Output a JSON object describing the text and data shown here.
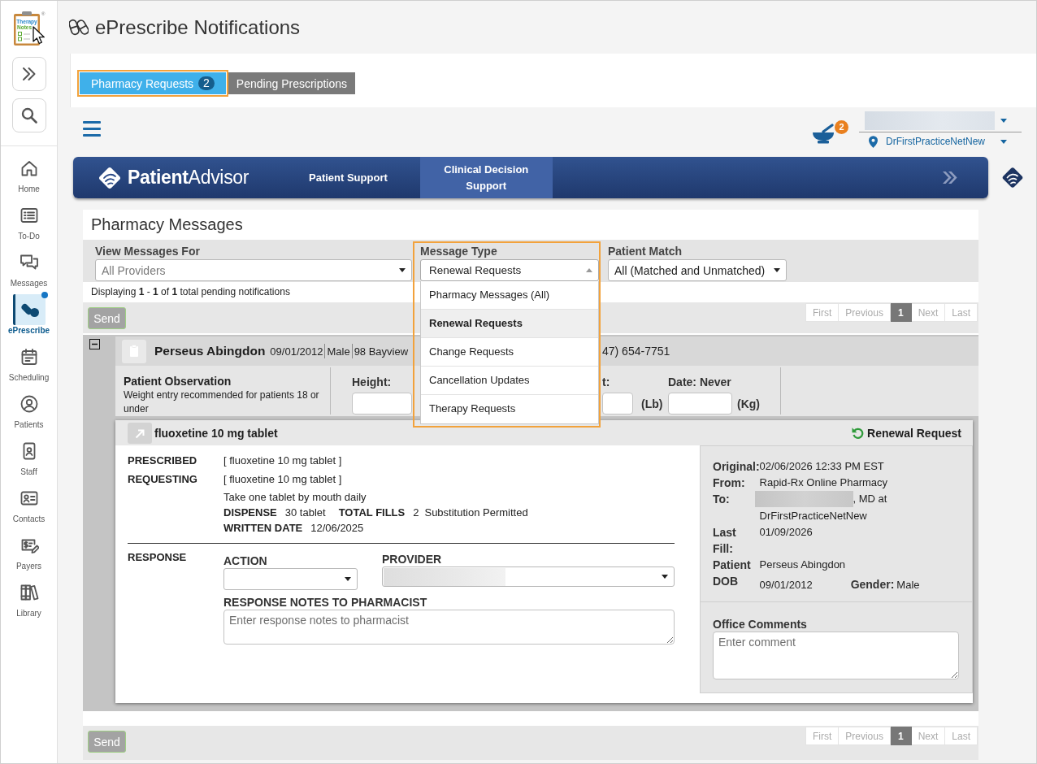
{
  "app_logo": {
    "line_1": "Therapy",
    "line_2": "Notes",
    "mark": "®"
  },
  "sidebar": {
    "items": [
      {
        "label": "Home",
        "selected": false,
        "dot": false
      },
      {
        "label": "To-Do",
        "selected": false,
        "dot": false
      },
      {
        "label": "Messages",
        "selected": false,
        "dot": false
      },
      {
        "label": "ePrescribe",
        "selected": true,
        "dot": true
      },
      {
        "label": "Scheduling",
        "selected": false,
        "dot": false
      },
      {
        "label": "Patients",
        "selected": false,
        "dot": false
      },
      {
        "label": "Staff",
        "selected": false,
        "dot": false
      },
      {
        "label": "Contacts",
        "selected": false,
        "dot": false
      },
      {
        "label": "Payers",
        "selected": false,
        "dot": false
      },
      {
        "label": "Library",
        "selected": false,
        "dot": false
      }
    ]
  },
  "page_title": "ePrescribe Notifications",
  "tabs": [
    {
      "label": "Pharmacy Requests",
      "count": "2",
      "selected": true,
      "highlighted": true
    },
    {
      "label": "Pending Prescriptions",
      "selected": false,
      "highlighted": false
    }
  ],
  "toolbar": {
    "notification_count": "2",
    "location": "DrFirstPracticeNetNew"
  },
  "banner": {
    "logo": "**Patient**Advisor",
    "links": [
      {
        "label": "Patient Support",
        "selected": false
      },
      {
        "label": "Clinical Decision Support",
        "selected": true
      }
    ]
  },
  "messages": {
    "title": "Pharmacy Messages",
    "filters": [
      {
        "label": "View Messages For",
        "placeholder": "All Providers",
        "expanded": false,
        "highlighted": false
      },
      {
        "label": "Message Type",
        "value": "Renewal Requests",
        "expanded": true,
        "highlighted": true,
        "options": [
          {
            "label": "Pharmacy Messages (All)",
            "selected": false
          },
          {
            "label": "Renewal Requests",
            "selected": true
          },
          {
            "label": "Change Requests",
            "selected": false
          },
          {
            "label": "Cancellation Updates",
            "selected": false
          },
          {
            "label": "Therapy Requests",
            "selected": false
          }
        ]
      },
      {
        "label": "Patient Match",
        "value": "All (Matched and Unmatched)",
        "expanded": false,
        "highlighted": false
      }
    ],
    "summary": "Displaying **1** - **1** of **1** total pending notifications"
  },
  "top_bar": {
    "send": {
      "label": "Send",
      "disabled": true
    },
    "pager": [
      {
        "label": "First",
        "selected": false,
        "disabled": true
      },
      {
        "label": "Previous",
        "selected": false,
        "disabled": true
      },
      {
        "label": "1",
        "selected": true,
        "disabled": false
      },
      {
        "label": "Next",
        "selected": false,
        "disabled": true
      },
      {
        "label": "Last",
        "selected": false,
        "disabled": true
      }
    ]
  },
  "patient": {
    "expanded": true,
    "name": "Perseus Abingdon",
    "dob": "09/01/2012",
    "gender": "Male",
    "address": "98 Bayview",
    "phone": "47) 654-7751",
    "observation": {
      "title": "Patient Observation",
      "note": "Weight entry recommended for patients 18 or under",
      "fields": [
        {
          "label": "Height:"
        },
        {
          "label": "t:",
          "unit": "(Lb)"
        },
        {
          "label": "Date: Never",
          "unit": "(Kg)"
        }
      ]
    }
  },
  "medication": {
    "name": "fluoxetine 10 mg tablet",
    "request_type": "Renewal Request",
    "lines": [
      {
        "label": "PRESCRIBED",
        "value": "[ fluoxetine 10 mg tablet ]"
      },
      {
        "label": "REQUESTING",
        "value": "[ fluoxetine 10 mg tablet ]"
      }
    ],
    "sig": "Take one tablet by mouth daily",
    "dispense": {
      "label": "DISPENSE",
      "value": "30 tablet"
    },
    "fills": {
      "label": "TOTAL FILLS",
      "value": "2"
    },
    "substitution": "Substitution Permitted",
    "written": {
      "label": "WRITTEN DATE",
      "value": "12/06/2025"
    },
    "response": {
      "label": "RESPONSE",
      "action_label": "ACTION",
      "provider_label": "PROVIDER",
      "notes_label": "RESPONSE NOTES TO PHARMACIST",
      "notes_placeholder": "Enter response notes to pharmacist"
    },
    "details": [
      {
        "kind": "text",
        "label": "Original:",
        "value": "02/06/2026 12:33 PM EST"
      },
      {
        "kind": "text",
        "label": "From:",
        "value": "Rapid-Rx Online Pharmacy"
      },
      {
        "kind": "recipient",
        "label": "To:",
        "value": ", MD at",
        "value_2": "DrFirstPracticeNetNew"
      },
      {
        "kind": "text",
        "label": "Last Fill:",
        "value": "01/09/2026"
      },
      {
        "kind": "text",
        "label": "Patient",
        "value": "Perseus Abingdon"
      },
      {
        "kind": "pair",
        "label": "DOB",
        "value": "09/01/2012",
        "label_2": "Gender:",
        "value_2": "Male"
      }
    ],
    "comments": {
      "label": "Office Comments",
      "placeholder": "Enter comment"
    }
  },
  "bottom_bar": {
    "send": {
      "label": "Send",
      "disabled": true
    },
    "pager": [
      {
        "label": "First",
        "selected": false,
        "disabled": true
      },
      {
        "label": "Previous",
        "selected": false,
        "disabled": true
      },
      {
        "label": "1",
        "selected": true,
        "disabled": false
      },
      {
        "label": "Next",
        "selected": false,
        "disabled": true
      },
      {
        "label": "Last",
        "selected": false,
        "disabled": true
      }
    ]
  }
}
